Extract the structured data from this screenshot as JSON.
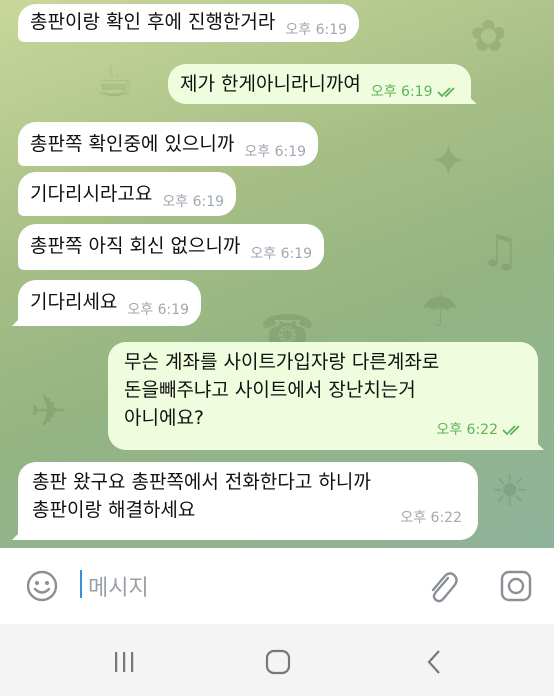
{
  "messages": [
    {
      "direction": "in",
      "text": "총판이랑 확인 후에 진행한거라",
      "time": "오후 6:19"
    },
    {
      "direction": "out",
      "text": "제가 한게아니라니까여",
      "time": "오후 6:19"
    },
    {
      "direction": "in",
      "text": "총판쪽 확인중에 있으니까",
      "time": "오후 6:19"
    },
    {
      "direction": "in",
      "text": "기다리시라고요",
      "time": "오후 6:19"
    },
    {
      "direction": "in",
      "text": "총판쪽 아직 회신 없으니까",
      "time": "오후 6:19"
    },
    {
      "direction": "in",
      "text": "기다리세요",
      "time": "오후 6:19"
    },
    {
      "direction": "out",
      "lines": [
        "무슨 계좌를 사이트가입자랑 다른계좌로",
        "돈을빼주냐고 사이트에서 장난치는거",
        "아니에요?"
      ],
      "time": "오후 6:22"
    },
    {
      "direction": "in",
      "lines": [
        "총판 왔구요 총판쪽에서 전화한다고 하니까",
        "총판이랑 해결하세요"
      ],
      "time": "오후 6:22"
    }
  ],
  "input": {
    "placeholder": "메시지",
    "emoji_icon": "emoji-icon",
    "attach_icon": "paperclip-icon",
    "camera_icon": "camera-icon"
  },
  "nav": {
    "recents_icon": "recents-icon",
    "home_icon": "home-icon",
    "back_icon": "back-icon"
  },
  "colors": {
    "incoming_bubble": "#ffffff",
    "outgoing_bubble": "#effdde",
    "outgoing_time": "#5db35a",
    "incoming_time": "#a0a8b0",
    "caret": "#3a8fd9"
  }
}
